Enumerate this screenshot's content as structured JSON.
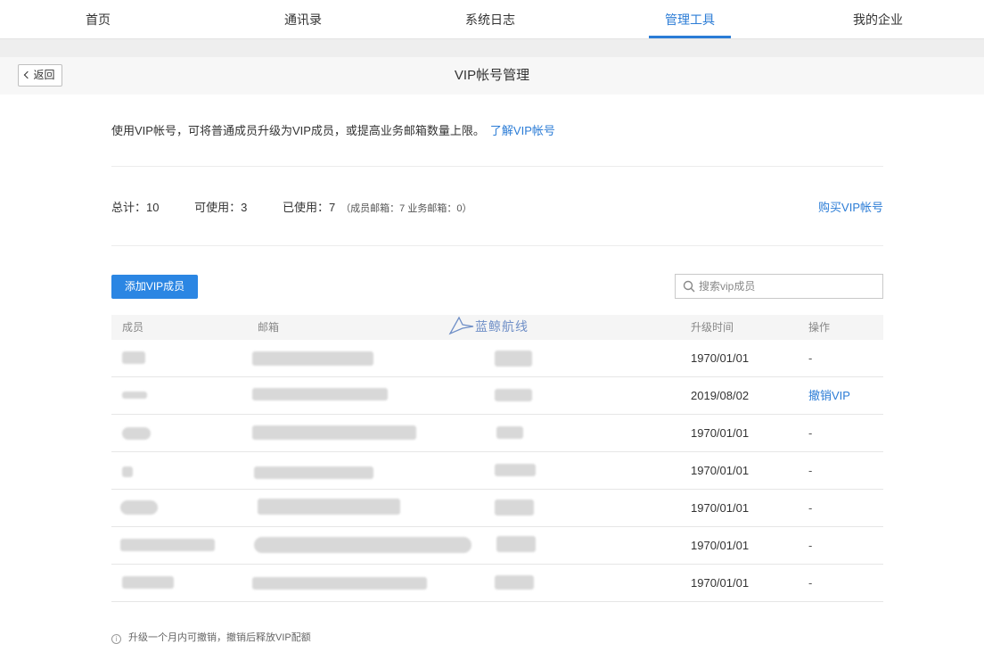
{
  "nav": {
    "items": [
      {
        "label": "首页",
        "active": false
      },
      {
        "label": "通讯录",
        "active": false
      },
      {
        "label": "系统日志",
        "active": false
      },
      {
        "label": "管理工具",
        "active": true
      },
      {
        "label": "我的企业",
        "active": false
      }
    ],
    "accent_color": "#2b7cd6"
  },
  "subheader": {
    "back_label": "返回",
    "title": "VIP帐号管理"
  },
  "intro": {
    "text": "使用VIP帐号，可将普通成员升级为VIP成员，或提高业务邮箱数量上限。",
    "link": "了解VIP帐号"
  },
  "stats": {
    "total": "总计：10",
    "available": "可使用：3",
    "used": "已使用：7",
    "used_detail": "（成员邮箱：7  业务邮箱：0）",
    "buy_link": "购买VIP帐号"
  },
  "actions": {
    "add_button": "添加VIP成员",
    "search_placeholder": "搜索vip成员"
  },
  "table": {
    "headers": [
      "成员",
      "邮箱",
      "升级时间",
      "操作"
    ],
    "rows": [
      {
        "upgrade_time": "1970/01/01",
        "action": "-",
        "action_is_link": false
      },
      {
        "upgrade_time": "2019/08/02",
        "action": "撤销VIP",
        "action_is_link": true
      },
      {
        "upgrade_time": "1970/01/01",
        "action": "-",
        "action_is_link": false
      },
      {
        "upgrade_time": "1970/01/01",
        "action": "-",
        "action_is_link": false
      },
      {
        "upgrade_time": "1970/01/01",
        "action": "-",
        "action_is_link": false
      },
      {
        "upgrade_time": "1970/01/01",
        "action": "-",
        "action_is_link": false
      },
      {
        "upgrade_time": "1970/01/01",
        "action": "-",
        "action_is_link": false
      }
    ]
  },
  "watermark": "蓝鲸航线",
  "footer_note": "升级一个月内可撤销，撤销后释放VIP配额"
}
